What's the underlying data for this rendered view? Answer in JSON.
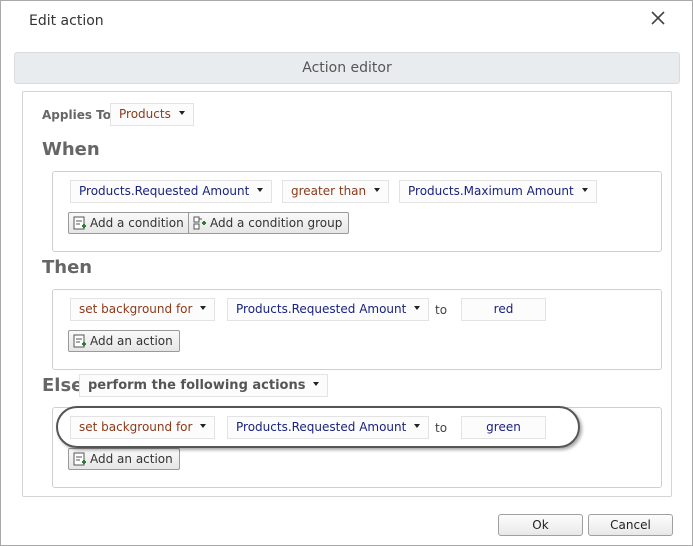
{
  "dialog": {
    "title": "Edit action",
    "close_icon": "close-icon"
  },
  "editor": {
    "header": "Action editor",
    "applies_to": {
      "label": "Applies To",
      "value": "Products"
    },
    "when": {
      "title": "When",
      "condition": {
        "field": "Products.Requested Amount",
        "operator": "greater than",
        "value": "Products.Maximum Amount"
      },
      "add_condition": "Add a condition",
      "add_condition_group": "Add a condition group"
    },
    "then": {
      "title": "Then",
      "action": {
        "action": "set background for",
        "field": "Products.Requested Amount",
        "to": "to",
        "value": "red"
      },
      "add_action": "Add an action"
    },
    "else": {
      "title": "Else",
      "mode": "perform the following actions",
      "action": {
        "action": "set background for",
        "field": "Products.Requested Amount",
        "to": "to",
        "value": "green"
      },
      "add_action": "Add an action"
    }
  },
  "footer": {
    "ok": "Ok",
    "cancel": "Cancel"
  },
  "colors": {
    "field_text": "#1a237e",
    "operator_text": "#8b3a1a",
    "header_bg": "#e9ecef"
  }
}
